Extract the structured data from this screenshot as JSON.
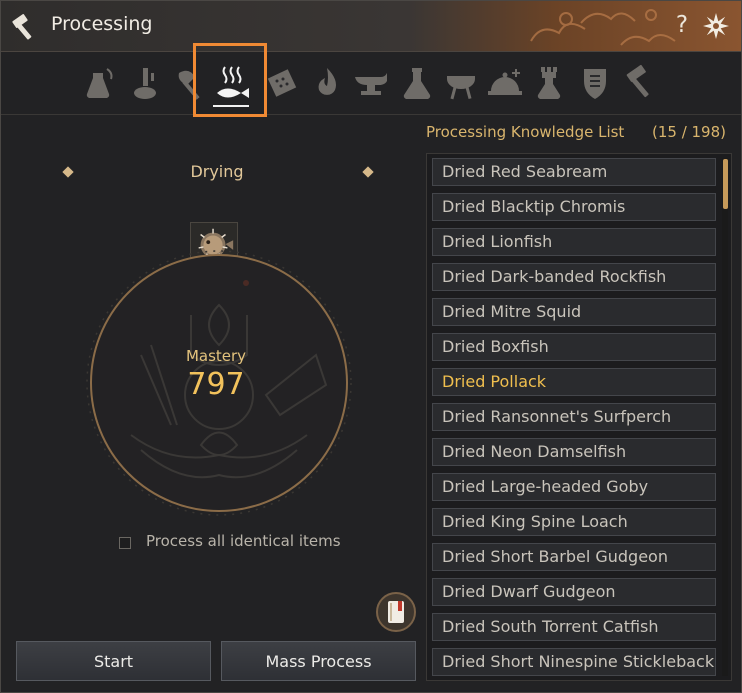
{
  "window": {
    "title": "Processing",
    "help_label": "?"
  },
  "tabs": [
    {
      "name": "tab-shaking",
      "icon": "flask-shake-icon"
    },
    {
      "name": "tab-grinding",
      "icon": "grind-icon"
    },
    {
      "name": "tab-chopping",
      "icon": "axe-icon"
    },
    {
      "name": "tab-drying",
      "icon": "drying-fish-icon",
      "active": true
    },
    {
      "name": "tab-filtering",
      "icon": "filter-icon"
    },
    {
      "name": "tab-heating",
      "icon": "flame-icon"
    },
    {
      "name": "tab-smithing",
      "icon": "anvil-icon"
    },
    {
      "name": "tab-alchemy",
      "icon": "alchemy-flask-icon"
    },
    {
      "name": "tab-cooking",
      "icon": "grill-icon"
    },
    {
      "name": "tab-imperial-cooking",
      "icon": "cloche-icon"
    },
    {
      "name": "tab-imperial-alchemy",
      "icon": "tower-flask-icon"
    },
    {
      "name": "tab-guild",
      "icon": "shield-icon"
    },
    {
      "name": "tab-manufacture",
      "icon": "hammer-icon"
    }
  ],
  "left": {
    "category_label": "Drying",
    "mastery_label": "Mastery",
    "mastery_value": "797",
    "process_all_label": "Process all identical items",
    "process_all_checked": false,
    "start_label": "Start",
    "mass_process_label": "Mass Process"
  },
  "knowledge": {
    "title": "Processing Knowledge List",
    "count": "(15 / 198)",
    "items": [
      {
        "label": "Dried Red Seabream",
        "highlight": false
      },
      {
        "label": "Dried Blacktip Chromis",
        "highlight": false
      },
      {
        "label": "Dried Lionfish",
        "highlight": false
      },
      {
        "label": "Dried Dark-banded Rockfish",
        "highlight": false
      },
      {
        "label": "Dried Mitre Squid",
        "highlight": false
      },
      {
        "label": "Dried Boxfish",
        "highlight": false
      },
      {
        "label": "Dried Pollack",
        "highlight": true
      },
      {
        "label": "Dried Ransonnet's Surfperch",
        "highlight": false
      },
      {
        "label": "Dried Neon Damselfish",
        "highlight": false
      },
      {
        "label": "Dried Large-headed Goby",
        "highlight": false
      },
      {
        "label": "Dried King Spine Loach",
        "highlight": false
      },
      {
        "label": "Dried Short Barbel Gudgeon",
        "highlight": false
      },
      {
        "label": "Dried Dwarf Gudgeon",
        "highlight": false
      },
      {
        "label": "Dried South Torrent Catfish",
        "highlight": false
      },
      {
        "label": "Dried Short Ninespine Stickleback",
        "highlight": false
      }
    ]
  },
  "colors": {
    "accent_orange": "#f08a34",
    "gold_text": "#f0bf4e"
  }
}
